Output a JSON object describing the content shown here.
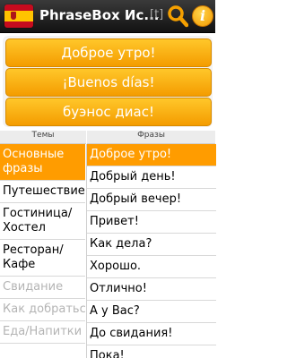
{
  "app": {
    "title": "PhraseBox Ис...",
    "translit_label": "[t]"
  },
  "buttons": {
    "russian": "Доброе утро!",
    "spanish": "¡Buenos días!",
    "translit": "буэнос диас!"
  },
  "headers": {
    "topics": "Темы",
    "phrases": "Фразы"
  },
  "topics": [
    {
      "label": "Основные фразы"
    },
    {
      "label": "Путешествие"
    },
    {
      "label": "Гостиница/Хостел"
    },
    {
      "label": "Ресторан/Кафе"
    },
    {
      "label": "Свидание"
    },
    {
      "label": "Как добраться ..."
    },
    {
      "label": "Еда/Напитки"
    }
  ],
  "phrases": [
    "Доброе утро!",
    "Добрый день!",
    "Добрый вечер!",
    "Привет!",
    "Как дела?",
    "Хорошо.",
    "Отлично!",
    "А у Вас?",
    "До свидания!",
    "Пока!"
  ],
  "colors": {
    "accent": "#ff9c00",
    "title_bar": "#1e1e1e"
  },
  "icons": {
    "flag": "spain-flag-icon",
    "search": "search-icon",
    "info": "info-icon"
  }
}
